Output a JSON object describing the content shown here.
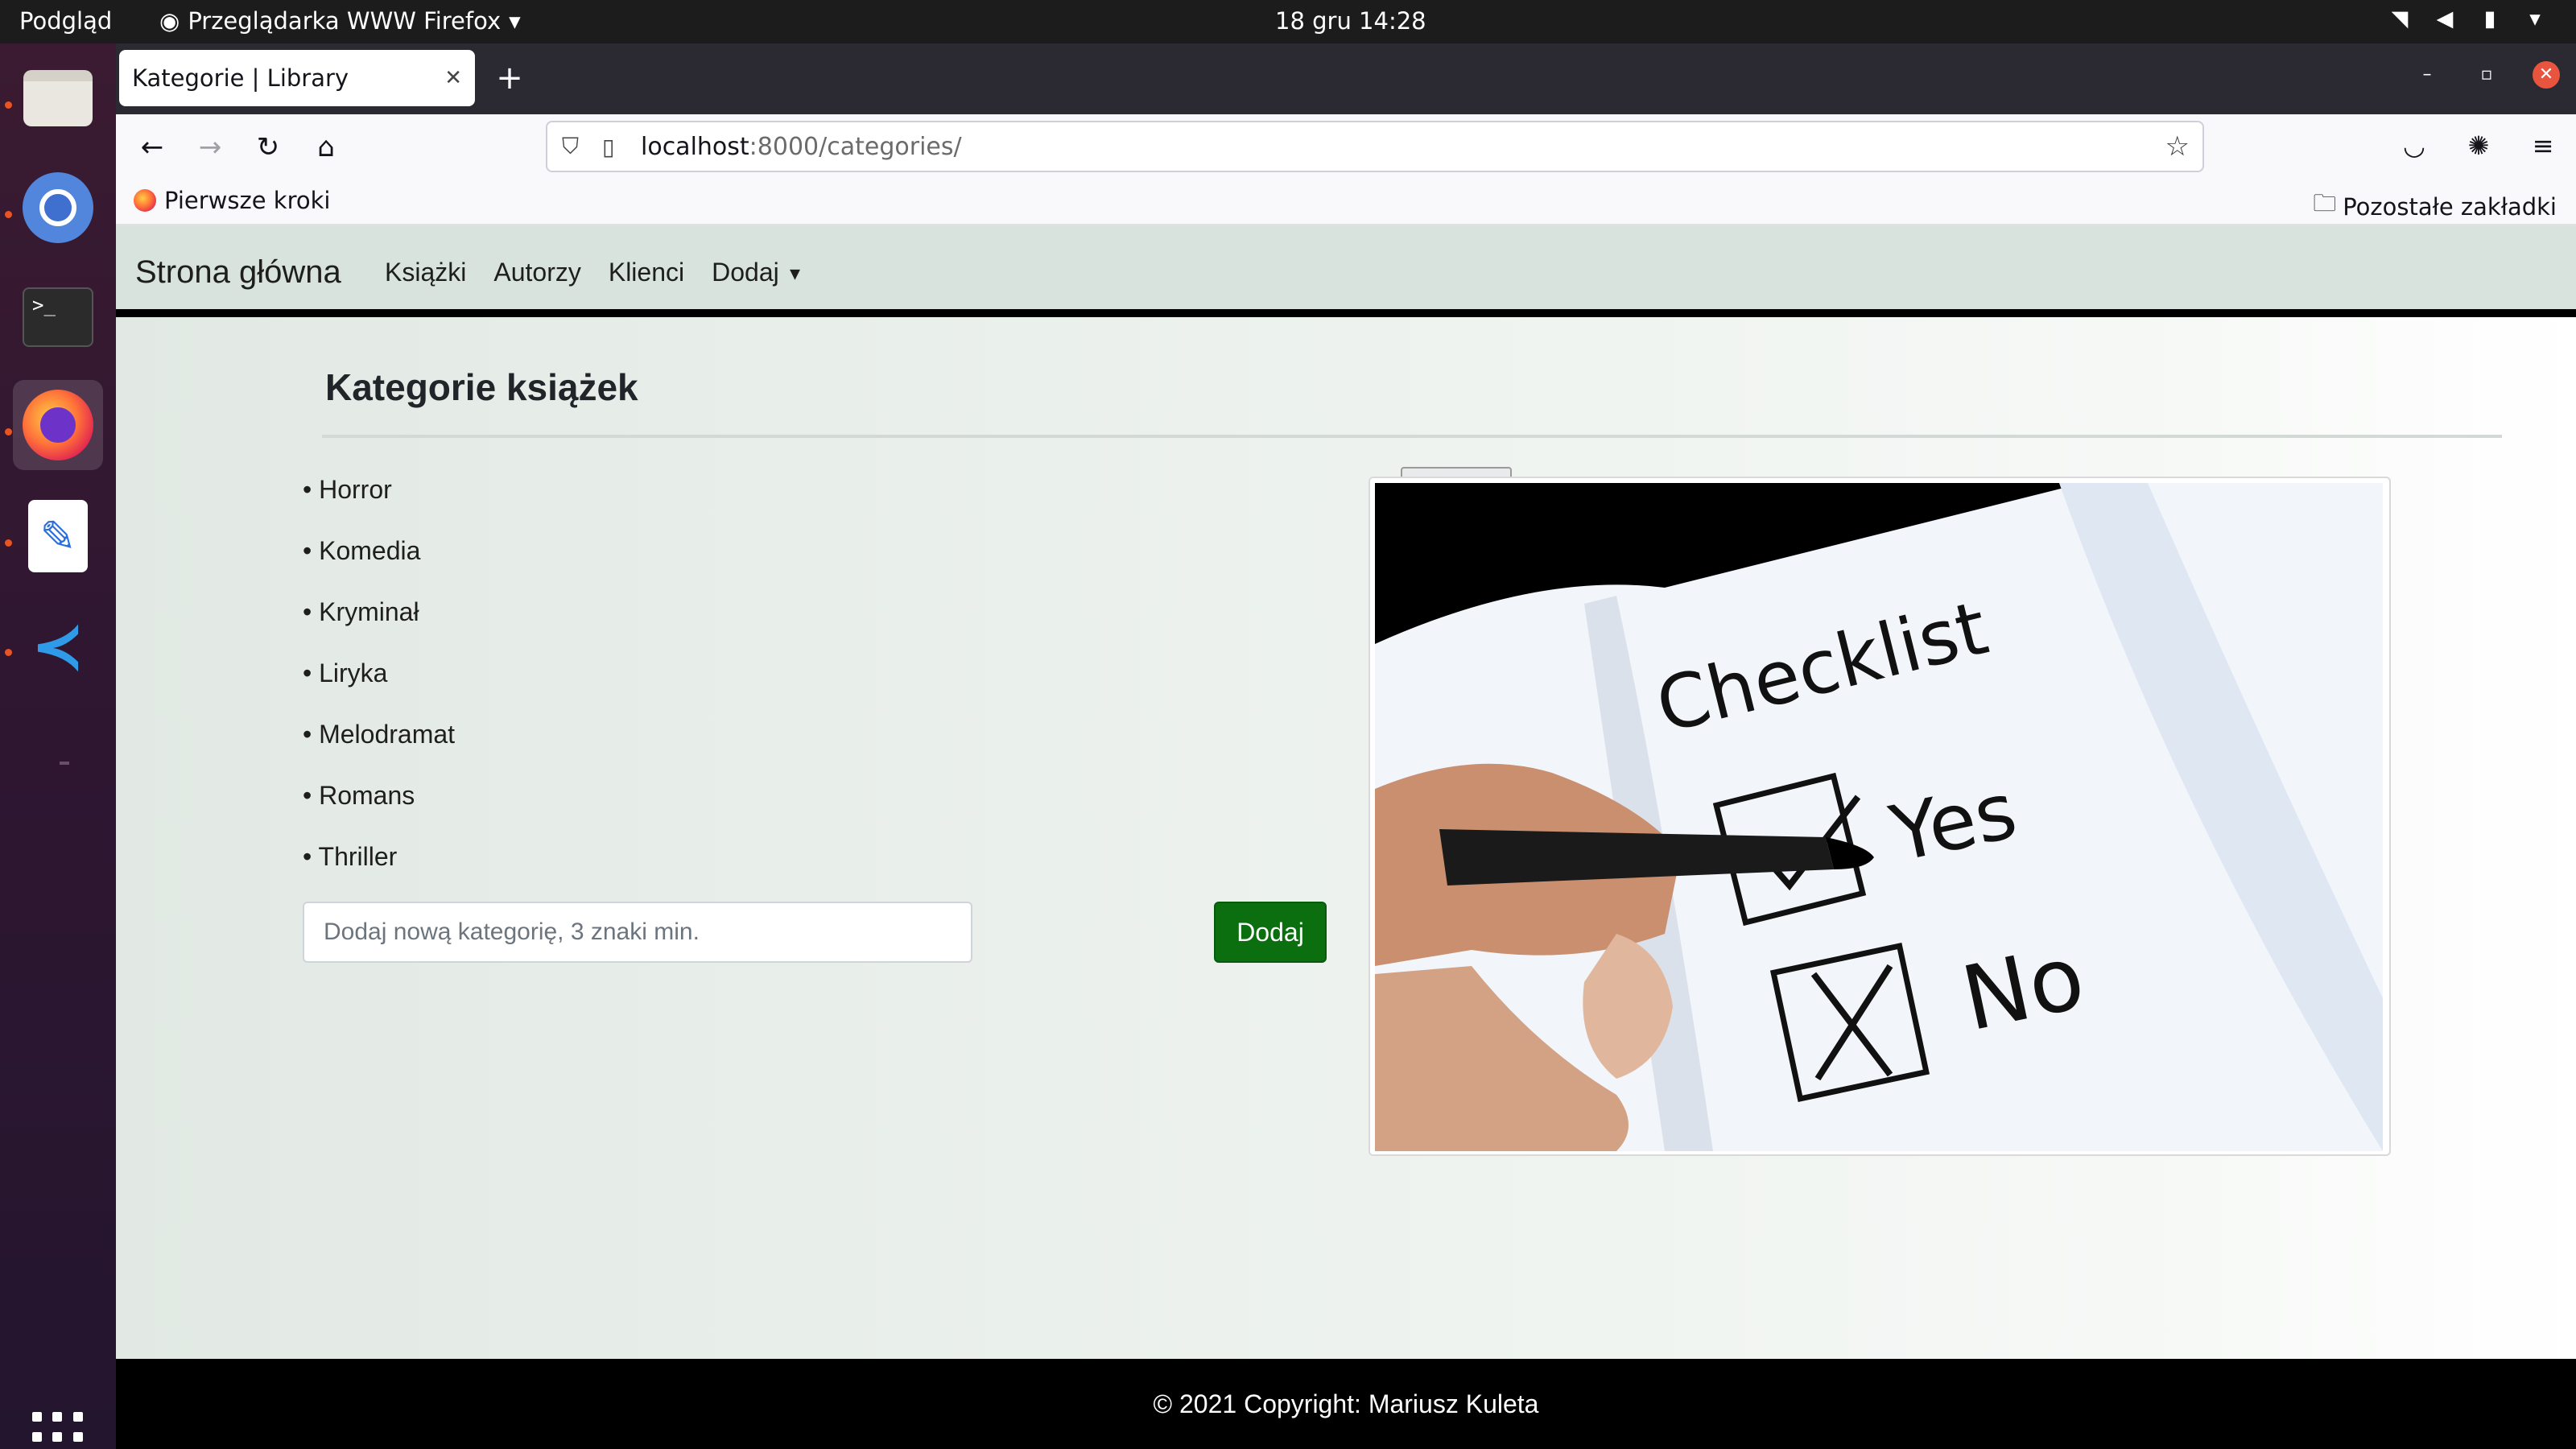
{
  "topbar": {
    "activities": "Podgląd",
    "app_name": "Przeglądarka WWW Firefox",
    "clock": "18 gru  14:28"
  },
  "dock": {
    "items": [
      "files-icon",
      "chromium-icon",
      "terminal-icon",
      "firefox-icon",
      "text-editor-icon",
      "vscode-icon"
    ]
  },
  "browser": {
    "tab_title": "Kategorie | Library",
    "url_host": "localhost",
    "url_path": ":8000/categories/",
    "bookmark_first": "Pierwsze kroki",
    "bookmark_other": "Pozostałe zakładki"
  },
  "site": {
    "brand": "Strona główna",
    "nav": [
      "Książki",
      "Autorzy",
      "Klienci",
      "Dodaj"
    ],
    "heading": "Kategorie książek",
    "categories": [
      "Horror",
      "Komedia",
      "Kryminał",
      "Liryka",
      "Melodramat",
      "Romans",
      "Thriller"
    ],
    "delete_label": "✗",
    "input_placeholder": "Dodaj nową kategorię, 3 znaki min.",
    "add_label": "Dodaj",
    "image_text": [
      "Checklist",
      "Yes",
      "No"
    ],
    "footer": "© 2021 Copyright: Mariusz Kuleta"
  }
}
